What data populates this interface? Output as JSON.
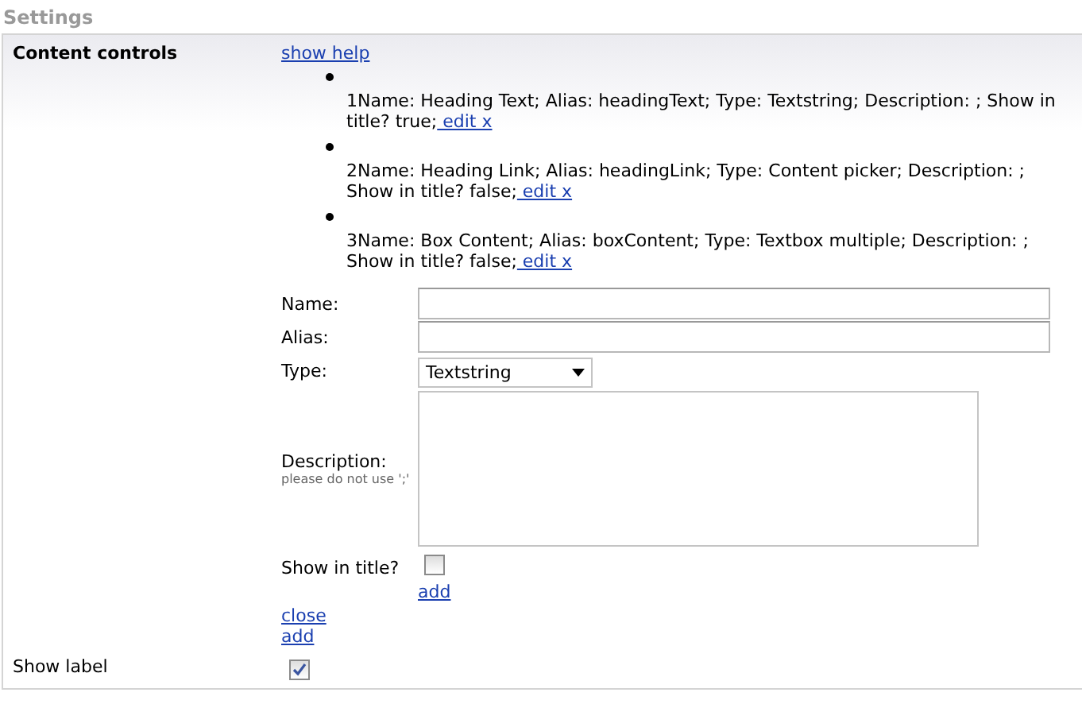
{
  "title": "Settings",
  "content_controls": {
    "label": "Content controls",
    "help_link": "show help",
    "items": [
      {
        "text": "1Name: Heading Text; Alias: headingText; Type: Textstring; Description: ; Show in title? true;",
        "link": " edit x"
      },
      {
        "text": "2Name: Heading Link; Alias: headingLink; Type: Content picker; Description: ; Show in title? false;",
        "link": " edit x"
      },
      {
        "text": "3Name: Box Content; Alias: boxContent; Type: Textbox multiple; Description: ; Show in title? false;",
        "link": " edit x"
      }
    ],
    "form": {
      "name_label": "Name:",
      "alias_label": "Alias:",
      "type_label": "Type:",
      "type_value": "Textstring",
      "description_label": "Description:",
      "description_hint": "please do not use ';'",
      "show_in_title_label": "Show in title?",
      "show_in_title_checked": false,
      "add_link": "add"
    },
    "close_link": "close",
    "add_link": "add"
  },
  "show_label": {
    "label": "Show label",
    "checked": true
  }
}
